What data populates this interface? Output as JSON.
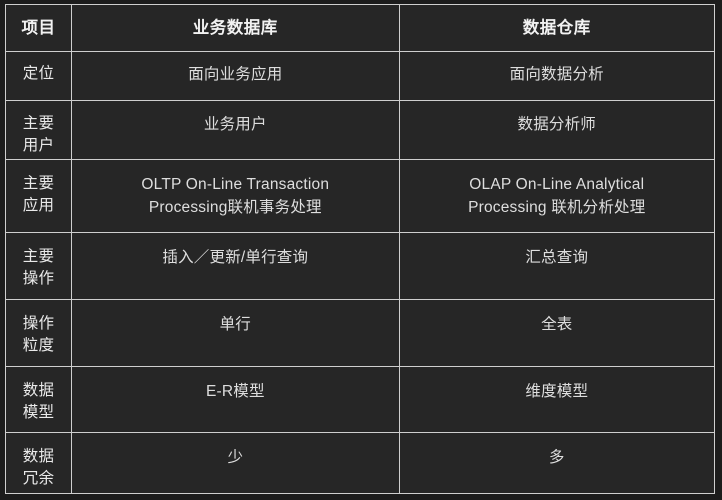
{
  "table": {
    "columns": [
      {
        "key": "item",
        "label": "项目"
      },
      {
        "key": "operational",
        "label": "业务数据库"
      },
      {
        "key": "warehouse",
        "label": "数据仓库"
      }
    ],
    "rows": [
      {
        "label": "定位",
        "operational": "面向业务应用",
        "warehouse": "面向数据分析"
      },
      {
        "label": "主要\n用户",
        "operational": "业务用户",
        "warehouse": "数据分析师"
      },
      {
        "label": "主要\n应用",
        "operational": "OLTP On-Line Transaction\nProcessing联机事务处理",
        "warehouse": "OLAP On-Line Analytical\nProcessing 联机分析处理"
      },
      {
        "label": "主要\n操作",
        "operational": "插入／更新/单行查询",
        "warehouse": "汇总查询"
      },
      {
        "label": "操作\n粒度",
        "operational": "单行",
        "warehouse": "全表"
      },
      {
        "label": "数据\n模型",
        "operational": "E-R模型",
        "warehouse": "维度模型"
      },
      {
        "label": "数据\n冗余",
        "operational": "少",
        "warehouse": "多"
      }
    ]
  },
  "theme": {
    "page_background": "#1c1c1c",
    "cell_background": "#262626",
    "border_color": "#cfcfcf",
    "header_text_color": "#f2f2f2",
    "body_text_color": "#dedede"
  }
}
